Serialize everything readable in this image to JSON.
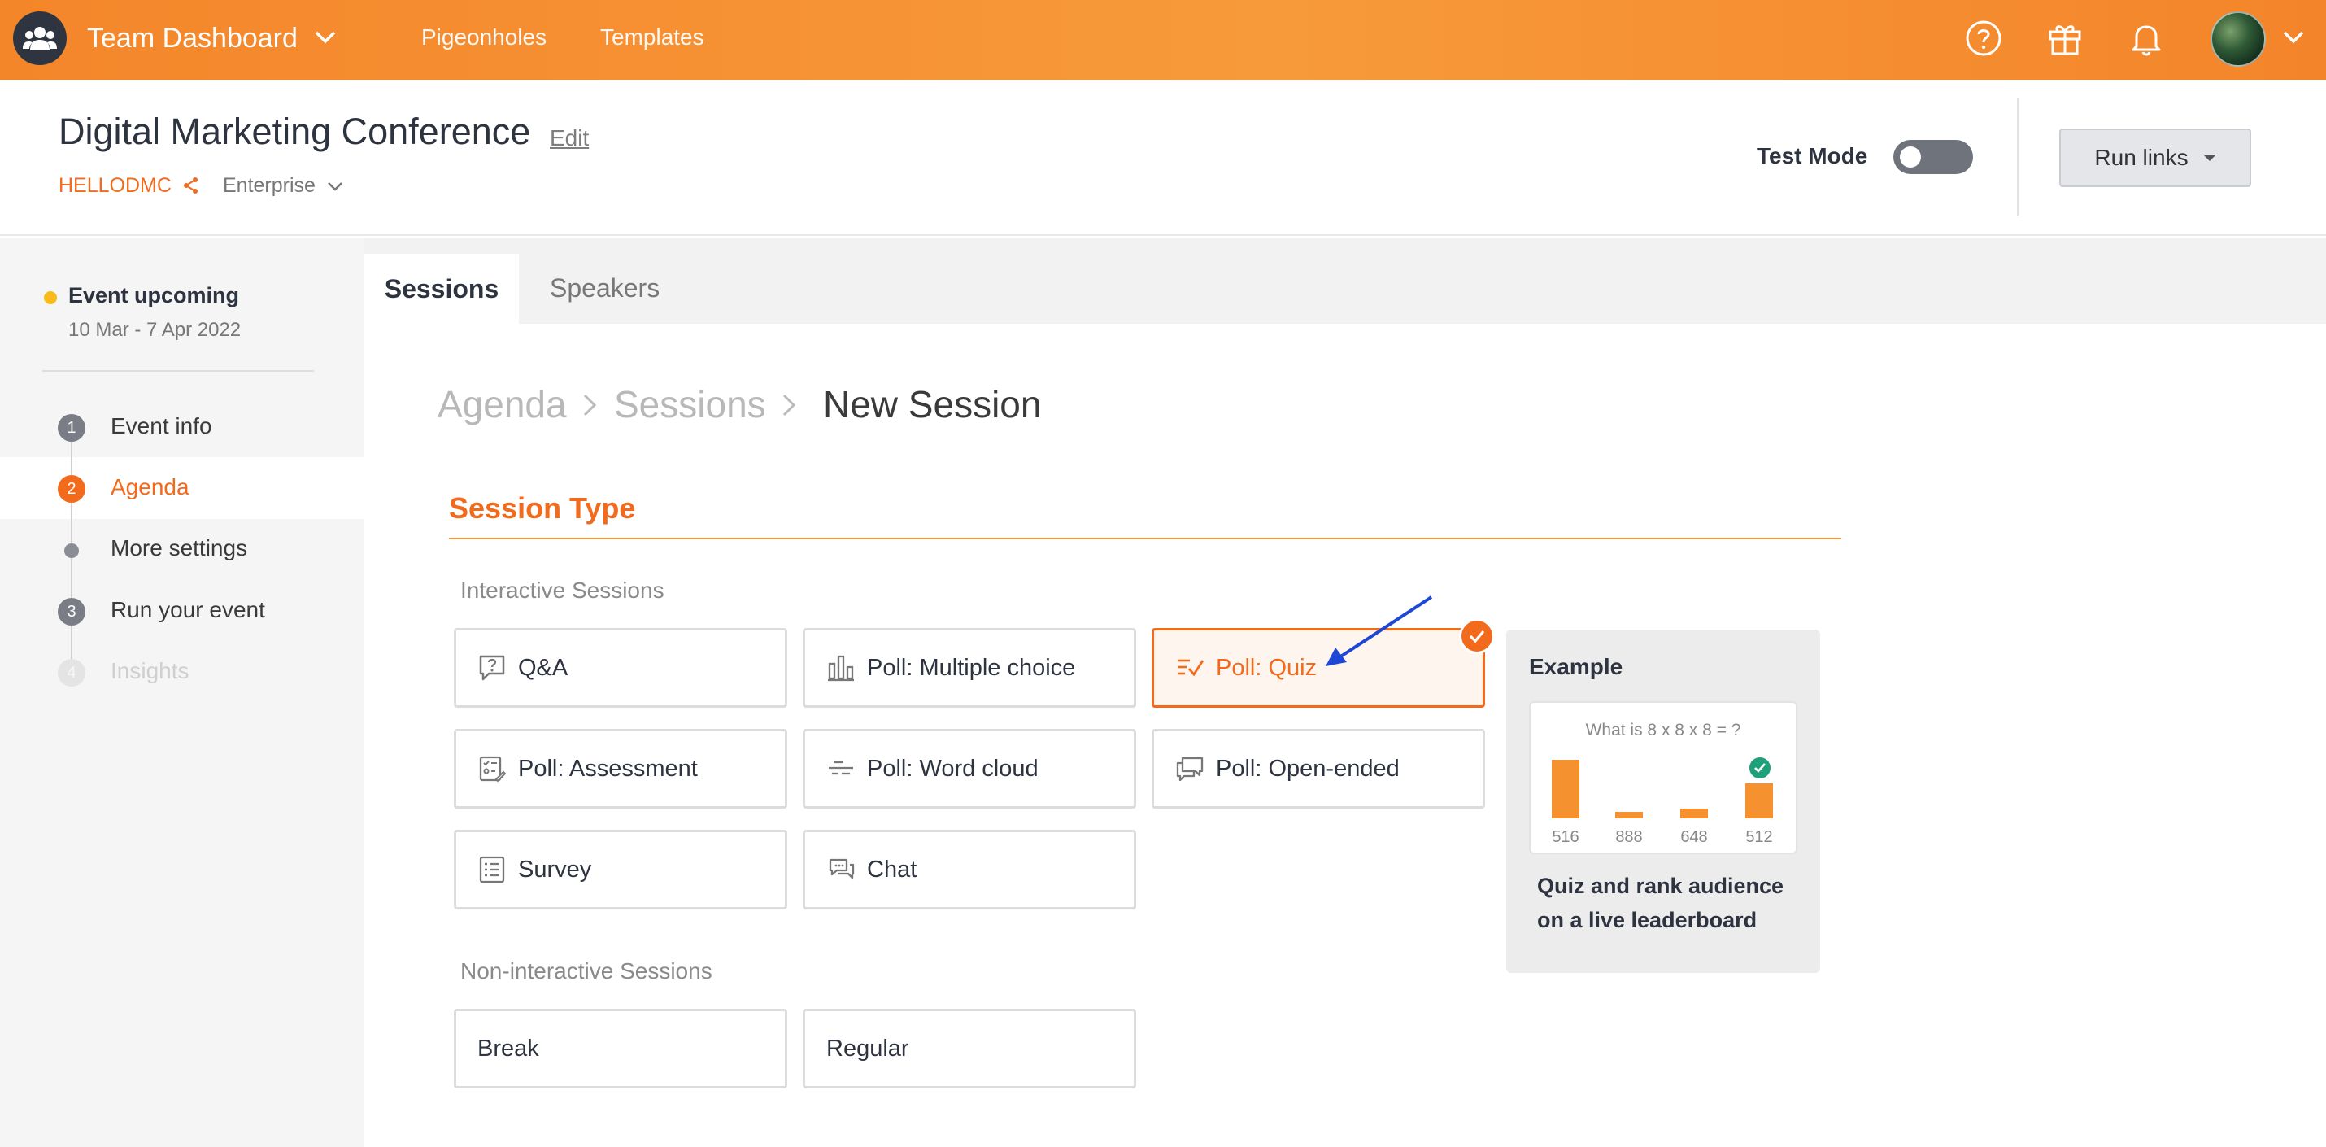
{
  "topbar": {
    "team_title": "Team Dashboard",
    "nav": [
      "Pigeonholes",
      "Templates"
    ],
    "icons": [
      "help-icon",
      "gift-icon",
      "bell-icon"
    ],
    "accent": "#f4862a"
  },
  "header": {
    "event_title": "Digital Marketing Conference",
    "edit": "Edit",
    "event_code": "HELLODMC",
    "plan": "Enterprise",
    "test_mode_label": "Test Mode",
    "test_mode_on": false,
    "run_links": "Run links"
  },
  "sidebar": {
    "status": "Event upcoming",
    "dates": "10 Mar - 7 Apr 2022",
    "steps": [
      {
        "num": "1",
        "label": "Event info"
      },
      {
        "num": "2",
        "label": "Agenda"
      },
      {
        "num": "",
        "label": "More settings"
      },
      {
        "num": "3",
        "label": "Run your event"
      },
      {
        "num": "4",
        "label": "Insights"
      }
    ]
  },
  "tabs": [
    "Sessions",
    "Speakers"
  ],
  "breadcrumb": [
    "Agenda",
    "Sessions",
    "New Session"
  ],
  "session_type": {
    "title": "Session Type",
    "interactive_label": "Interactive Sessions",
    "interactive": [
      {
        "label": "Q&A",
        "icon": "qa-icon"
      },
      {
        "label": "Poll: Multiple choice",
        "icon": "bar-chart-icon"
      },
      {
        "label": "Poll: Quiz",
        "icon": "quiz-check-icon",
        "selected": true
      },
      {
        "label": "Poll: Assessment",
        "icon": "assessment-icon"
      },
      {
        "label": "Poll: Word cloud",
        "icon": "word-cloud-icon"
      },
      {
        "label": "Poll: Open-ended",
        "icon": "chat-bubbles-icon"
      },
      {
        "label": "Survey",
        "icon": "survey-icon"
      },
      {
        "label": "Chat",
        "icon": "chat-icon"
      }
    ],
    "non_interactive_label": "Non-interactive Sessions",
    "non_interactive": [
      {
        "label": "Break"
      },
      {
        "label": "Regular"
      }
    ]
  },
  "example": {
    "title": "Example",
    "question": "What is 8 x 8 x 8 = ?",
    "answers": [
      {
        "label": "516",
        "value": 0.75
      },
      {
        "label": "888",
        "value": 0.08
      },
      {
        "label": "648",
        "value": 0.13
      },
      {
        "label": "512",
        "value": 0.45,
        "correct": true
      }
    ],
    "description": "Quiz and rank audience on a live leaderboard"
  }
}
